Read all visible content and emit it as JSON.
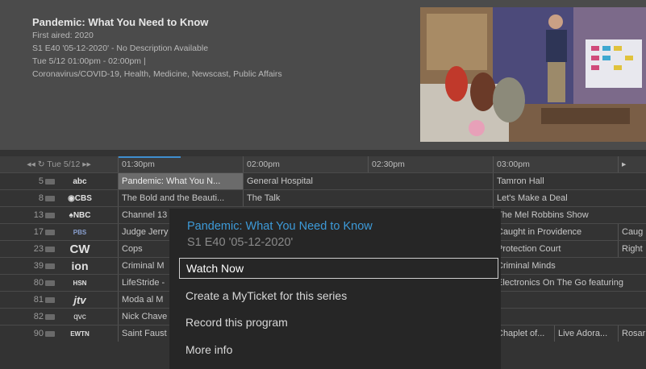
{
  "program": {
    "title": "Pandemic: What You Need to Know",
    "first_aired": "First aired: 2020",
    "episode": "S1 E40 '05-12-2020' - No Description Available",
    "time": "Tue 5/12 01:00pm - 02:00pm |",
    "genres": "Coronavirus/COVID-19, Health, Medicine, Newscast, Public Affairs"
  },
  "guide": {
    "date_label": "◂◂ ↻ Tue 5/12 ▸▸",
    "times": [
      "01:30pm",
      "02:00pm",
      "02:30pm",
      "03:00pm"
    ],
    "next_arrow": "▸",
    "rows": [
      {
        "num": "5",
        "logo": "abc",
        "cells": [
          "Pandemic: What You N...",
          "General Hospital",
          "Tamron Hall",
          ""
        ]
      },
      {
        "num": "8",
        "logo": "◉CBS",
        "cells": [
          "The Bold and the Beauti...",
          "The Talk",
          "Let's Make a Deal",
          ""
        ]
      },
      {
        "num": "13",
        "logo": "♠NBC",
        "cells": [
          "Channel 13",
          "",
          "The Mel Robbins Show",
          ""
        ]
      },
      {
        "num": "17",
        "logo": "PBS",
        "cells": [
          "Judge Jerry",
          "",
          "Caught in Providence",
          "Caug"
        ]
      },
      {
        "num": "23",
        "logo": "CW",
        "cells": [
          "Cops",
          "",
          "Protection Court",
          "Right"
        ]
      },
      {
        "num": "39",
        "logo": "ion",
        "cells": [
          "Criminal M",
          "",
          "Criminal Minds",
          ""
        ]
      },
      {
        "num": "80",
        "logo": "HSN",
        "cells": [
          "LifeStride -",
          "",
          "Electronics On The Go featuring",
          ""
        ]
      },
      {
        "num": "81",
        "logo": "jtv",
        "cells": [
          "Moda al M",
          "",
          "",
          ""
        ]
      },
      {
        "num": "82",
        "logo": "qvc",
        "cells": [
          "Nick Chave",
          "",
          "",
          ""
        ]
      },
      {
        "num": "90",
        "logo": "EWTN",
        "cells": [
          "Saint Faust",
          "",
          "Chaplet of...",
          "Live Adora...",
          "Rosar"
        ]
      }
    ]
  },
  "menu": {
    "title": "Pandemic: What You Need to Know",
    "subtitle": "S1 E40 '05-12-2020'",
    "options": [
      "Watch Now",
      "Create a MyTicket for this series",
      "Record this program",
      "More info"
    ]
  }
}
